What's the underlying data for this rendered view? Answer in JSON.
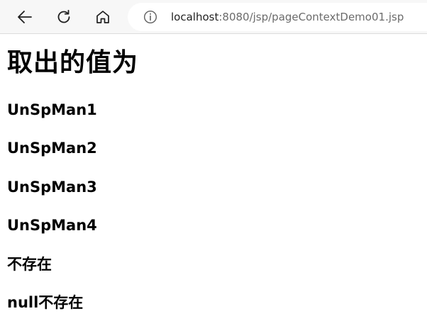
{
  "browser": {
    "url_host": "localhost",
    "url_rest": ":8080/jsp/pageContextDemo01.jsp"
  },
  "page": {
    "title": "取出的值为",
    "lines": [
      "UnSpMan1",
      "UnSpMan2",
      "UnSpMan3",
      "UnSpMan4",
      "不存在",
      "null不存在"
    ]
  },
  "icons": {
    "back": "back-arrow-icon",
    "refresh": "refresh-icon",
    "home": "home-icon",
    "info": "info-icon"
  }
}
